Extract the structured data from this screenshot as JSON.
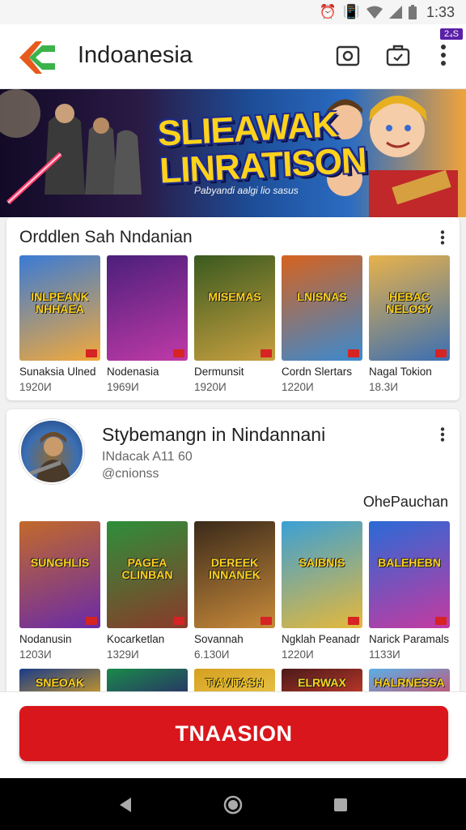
{
  "status_bar": {
    "time": "1:33",
    "icons": [
      "alarm-icon",
      "vibrate-icon",
      "wifi-icon",
      "signal-icon",
      "battery-icon"
    ]
  },
  "app_bar": {
    "title": "Indoanesia",
    "badge": "2₄S",
    "icons": [
      "back-arrow-logo-icon",
      "camera-icon",
      "bag-icon",
      "more-vert-icon"
    ],
    "logo_colors": [
      "#e85a1b",
      "#3bb34a"
    ]
  },
  "banner": {
    "title": "SLIEAWAK LINRATISON",
    "title_line1": "SLIEAWAK",
    "title_line2": "LINRATISON",
    "subtitle": "Pabyandi aalgi lio sasus"
  },
  "section1": {
    "title": "Orddlen Sah Nndanian",
    "items": [
      {
        "name": "Sunaksia Ulned",
        "sub": "1920И",
        "cover_text": "INLPEANK NHHAEA",
        "colors": [
          "#3a7bd5",
          "#f2a93b"
        ]
      },
      {
        "name": "Nodenasia",
        "sub": "1969И",
        "cover_text": "",
        "colors": [
          "#4b1f7a",
          "#c03aa8"
        ]
      },
      {
        "name": "Dermunsit",
        "sub": "1920И",
        "cover_text": "MISEMAS",
        "colors": [
          "#3a5a1f",
          "#c8a040"
        ]
      },
      {
        "name": "Cordn Slertars",
        "sub": "1220И",
        "cover_text": "LNISNAS",
        "colors": [
          "#d6621e",
          "#3a8ad0"
        ]
      },
      {
        "name": "Nagal Tokion",
        "sub": "18.3И",
        "cover_text": "HEBAC NELOSY",
        "colors": [
          "#e8b24a",
          "#3b6fb3"
        ]
      }
    ]
  },
  "section2": {
    "developer_name": "Stybemangn in Nindannani",
    "developer_sub": "INdacak A11 60",
    "developer_handle": "@cnionss",
    "link": "OhePauchan",
    "items": [
      {
        "name": "Nodanusin",
        "sub": "1203И",
        "cover_text": "SUNGHLIS",
        "colors": [
          "#c26a2a",
          "#6a2aa8"
        ]
      },
      {
        "name": "Kocarketlan",
        "sub": "1329И",
        "cover_text": "PAGEA CLINBAN",
        "colors": [
          "#2e8f3a",
          "#8a3a2a"
        ]
      },
      {
        "name": "Sovannah",
        "sub": "6.130И",
        "cover_text": "DEREEK INNANEK",
        "colors": [
          "#3a2a1a",
          "#c88a3a"
        ]
      },
      {
        "name": "Ngklah Peanadr",
        "sub": "1220И",
        "cover_text": "SAIBNIS",
        "colors": [
          "#3aa0d6",
          "#e6b83a"
        ]
      },
      {
        "name": "Narick Paramals",
        "sub": "1133И",
        "cover_text": "BALEHEBN",
        "colors": [
          "#2a6ad6",
          "#c53aa0"
        ]
      }
    ],
    "row3": [
      {
        "cover_text": "SNEOAK",
        "colors": [
          "#1a3a8a",
          "#d6a020"
        ]
      },
      {
        "cover_text": "",
        "colors": [
          "#1a8a4a",
          "#2a2a6a"
        ]
      },
      {
        "cover_text": "TIAVITASH",
        "colors": [
          "#d6a020",
          "#e8c44a"
        ]
      },
      {
        "cover_text": "ELRWAX",
        "colors": [
          "#4a1a1a",
          "#c83a2a"
        ]
      },
      {
        "cover_text": "HALRNESSA",
        "colors": [
          "#5ab0e6",
          "#d04a6a"
        ]
      }
    ]
  },
  "cta": {
    "label": "TNAASION",
    "color": "#d9161b"
  },
  "nav": {
    "icons": [
      "back-triangle-icon",
      "home-circle-icon",
      "recents-square-icon"
    ]
  }
}
